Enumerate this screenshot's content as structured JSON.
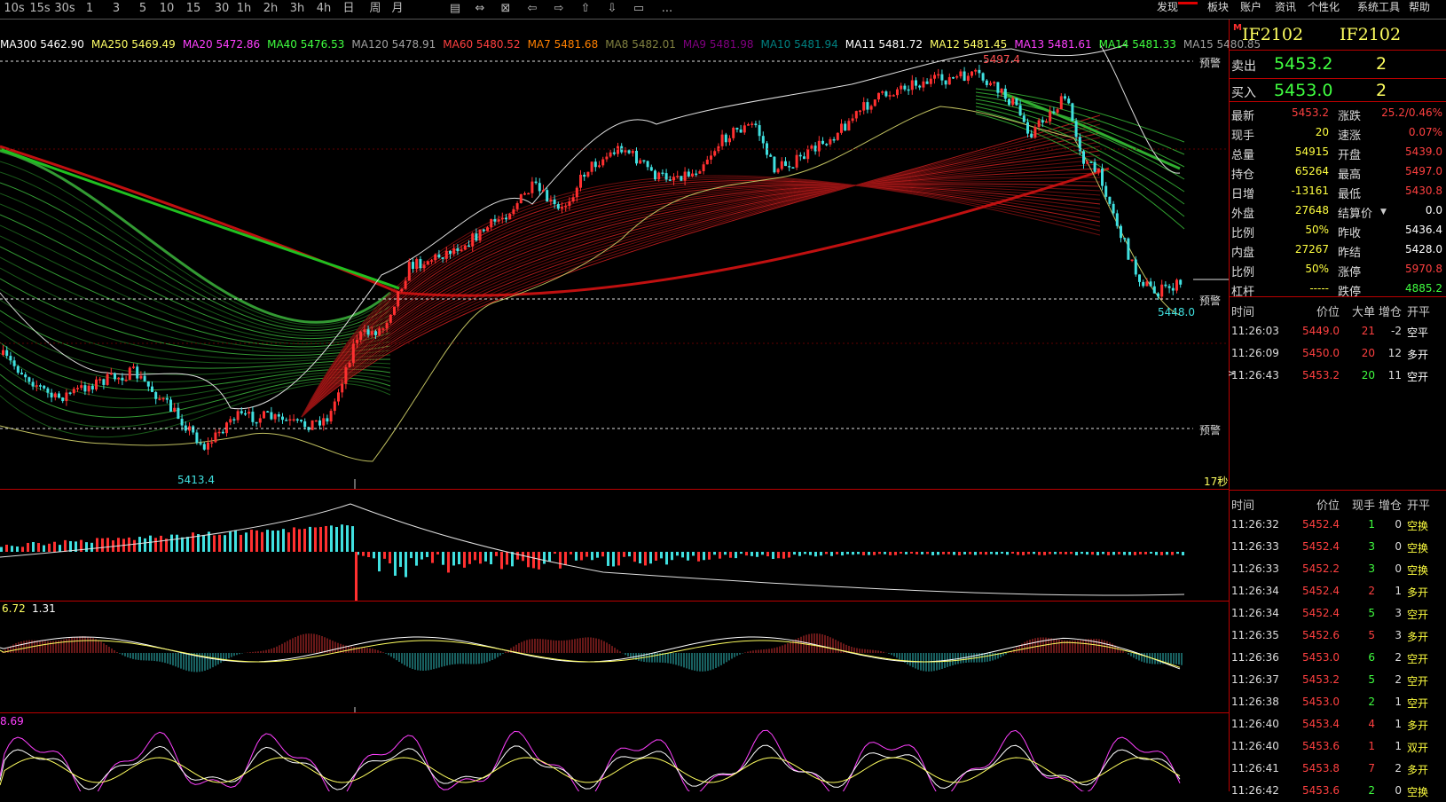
{
  "toolbar": {
    "periods": [
      "1分",
      "3分",
      "5分",
      "15分",
      "30分",
      "1小时",
      "2小时",
      "3小时",
      "4小时",
      "日",
      "周",
      "月"
    ],
    "periods_render": [
      "10s",
      "15s",
      "30s",
      "1",
      "3",
      "5",
      "10",
      "15",
      "30",
      "1h",
      "2h",
      "3h",
      "4h",
      "日",
      "周",
      "月"
    ],
    "more": "..."
  },
  "menu": {
    "items": [
      "发现",
      "板块",
      "账户",
      "资讯",
      "个性化",
      "系统工具",
      "帮助"
    ]
  },
  "ma_legend": [
    {
      "label": "MA300",
      "value": "5462.90",
      "color": "#ffffff"
    },
    {
      "label": "MA250",
      "value": "5469.49",
      "color": "#ffff66"
    },
    {
      "label": "MA20",
      "value": "5472.86",
      "color": "#ff40ff"
    },
    {
      "label": "MA40",
      "value": "5476.53",
      "color": "#40ff40"
    },
    {
      "label": "MA120",
      "value": "5478.91",
      "color": "#a0a0a0"
    },
    {
      "label": "MA60",
      "value": "5480.52",
      "color": "#ff4040"
    },
    {
      "label": "MA7",
      "value": "5481.68",
      "color": "#ff8000"
    },
    {
      "label": "MA8",
      "value": "5482.01",
      "color": "#808040"
    },
    {
      "label": "MA9",
      "value": "5481.98",
      "color": "#800080"
    },
    {
      "label": "MA10",
      "value": "5481.94",
      "color": "#008080"
    },
    {
      "label": "MA11",
      "value": "5481.72",
      "color": "#ffffff"
    },
    {
      "label": "MA12",
      "value": "5481.45",
      "color": "#ffff66"
    },
    {
      "label": "MA13",
      "value": "5481.61",
      "color": "#ff40ff"
    },
    {
      "label": "MA14",
      "value": "5481.33",
      "color": "#40ff40"
    },
    {
      "label": "MA15",
      "value": "5480.85",
      "color": "#a0a0a0"
    }
  ],
  "main_chart": {
    "high_label": "5497.4",
    "low_label": "5413.4",
    "last_low_label": "5448.0",
    "warn_label": "预警",
    "countdown": "17秒",
    "macd_labels": [
      "6.72",
      "1.31"
    ],
    "kdj_label": "8.69"
  },
  "quote": {
    "code_left": "IF2102",
    "code_right": "IF2102",
    "sell_label": "卖出",
    "sell_price": "5453.2",
    "sell_qty": "2",
    "buy_label": "买入",
    "buy_price": "5453.0",
    "buy_qty": "2",
    "stats": [
      {
        "l1": "最新",
        "v1": "5453.2",
        "c1": "#ff4040",
        "l2": "涨跌",
        "v2": "25.2/0.46%",
        "c2": "#ff4040"
      },
      {
        "l1": "现手",
        "v1": "20",
        "c1": "#ffff40",
        "l2": "速涨",
        "v2": "0.07%",
        "c2": "#ff4040"
      },
      {
        "l1": "总量",
        "v1": "54915",
        "c1": "#ffff40",
        "l2": "开盘",
        "v2": "5439.0",
        "c2": "#ff4040"
      },
      {
        "l1": "持仓",
        "v1": "65264",
        "c1": "#ffff40",
        "l2": "最高",
        "v2": "5497.0",
        "c2": "#ff4040"
      },
      {
        "l1": "日增",
        "v1": "-13161",
        "c1": "#ffff40",
        "l2": "最低",
        "v2": "5430.8",
        "c2": "#ff4040"
      },
      {
        "l1": "外盘",
        "v1": "27648",
        "c1": "#ffff40",
        "l2": "结算价",
        "v2": "0.0",
        "c2": "#ffffff"
      },
      {
        "l1": "比例",
        "v1": "50%",
        "c1": "#ffff40",
        "l2": "昨收",
        "v2": "5436.4",
        "c2": "#ffffff"
      },
      {
        "l1": "内盘",
        "v1": "27267",
        "c1": "#ffff40",
        "l2": "昨结",
        "v2": "5428.0",
        "c2": "#ffffff"
      },
      {
        "l1": "比例",
        "v1": "50%",
        "c1": "#ffff40",
        "l2": "涨停",
        "v2": "5970.8",
        "c2": "#ff4040"
      },
      {
        "l1": "杠杆",
        "v1": "-----",
        "c1": "#ffff40",
        "l2": "跌停",
        "v2": "4885.2",
        "c2": "#40ff40"
      }
    ]
  },
  "big_trades": {
    "headers": [
      "时间",
      "价位",
      "大单",
      "增仓",
      "开平"
    ],
    "rows": [
      {
        "time": "11:26:03",
        "price": "5449.0",
        "qty": "21",
        "chg": "-2",
        "type": "空平",
        "cq": "#ff4040",
        "ct": "#ffffff"
      },
      {
        "time": "11:26:09",
        "price": "5450.0",
        "qty": "20",
        "chg": "12",
        "type": "多开",
        "cq": "#ff4040",
        "ct": "#ffffff"
      },
      {
        "time": "11:26:43",
        "price": "5453.2",
        "qty": "20",
        "chg": "11",
        "type": "空开",
        "cq": "#40ff40",
        "ct": "#ffffff"
      }
    ]
  },
  "ticks": {
    "headers": [
      "时间",
      "价位",
      "现手",
      "增仓",
      "开平"
    ],
    "rows": [
      {
        "time": "11:26:32",
        "price": "5452.4",
        "qty": "1",
        "chg": "0",
        "type": "空换",
        "cq": "#40ff40",
        "ct": "#ffff40"
      },
      {
        "time": "11:26:33",
        "price": "5452.4",
        "qty": "3",
        "chg": "0",
        "type": "空换",
        "cq": "#40ff40",
        "ct": "#ffff40"
      },
      {
        "time": "11:26:33",
        "price": "5452.2",
        "qty": "3",
        "chg": "0",
        "type": "空换",
        "cq": "#40ff40",
        "ct": "#ffff40"
      },
      {
        "time": "11:26:34",
        "price": "5452.4",
        "qty": "2",
        "chg": "1",
        "type": "多开",
        "cq": "#ff4040",
        "ct": "#ffff40"
      },
      {
        "time": "11:26:34",
        "price": "5452.4",
        "qty": "5",
        "chg": "3",
        "type": "空开",
        "cq": "#40ff40",
        "ct": "#ffff40"
      },
      {
        "time": "11:26:35",
        "price": "5452.6",
        "qty": "5",
        "chg": "3",
        "type": "多开",
        "cq": "#ff4040",
        "ct": "#ffff40"
      },
      {
        "time": "11:26:36",
        "price": "5453.0",
        "qty": "6",
        "chg": "2",
        "type": "空开",
        "cq": "#40ff40",
        "ct": "#ffff40"
      },
      {
        "time": "11:26:37",
        "price": "5453.2",
        "qty": "5",
        "chg": "2",
        "type": "空开",
        "cq": "#40ff40",
        "ct": "#ffff40"
      },
      {
        "time": "11:26:38",
        "price": "5453.0",
        "qty": "2",
        "chg": "1",
        "type": "空开",
        "cq": "#40ff40",
        "ct": "#ffff40"
      },
      {
        "time": "11:26:40",
        "price": "5453.4",
        "qty": "4",
        "chg": "1",
        "type": "多开",
        "cq": "#ff4040",
        "ct": "#ffff40"
      },
      {
        "time": "11:26:40",
        "price": "5453.6",
        "qty": "1",
        "chg": "1",
        "type": "双开",
        "cq": "#ff4040",
        "ct": "#ffff40"
      },
      {
        "time": "11:26:41",
        "price": "5453.8",
        "qty": "7",
        "chg": "2",
        "type": "多开",
        "cq": "#ff4040",
        "ct": "#ffff40"
      },
      {
        "time": "11:26:42",
        "price": "5453.6",
        "qty": "2",
        "chg": "0",
        "type": "空换",
        "cq": "#40ff40",
        "ct": "#ffff40"
      }
    ]
  },
  "colors": {
    "up": "#ff3030",
    "down": "#40e0e0",
    "ma_green": "#20c020",
    "ma_red": "#c01010",
    "divider": "#b00000"
  }
}
